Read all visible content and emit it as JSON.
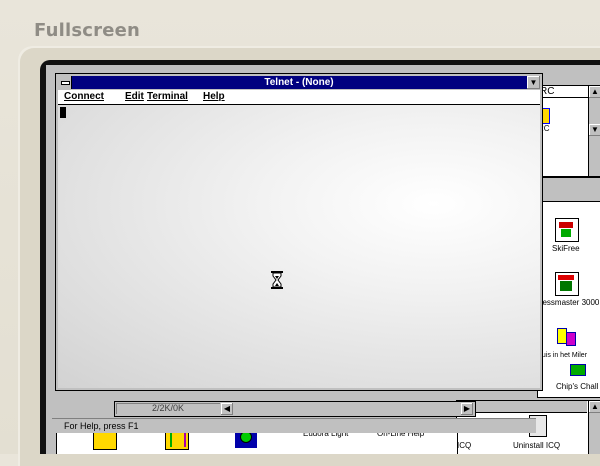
{
  "page_header": "Fullscreen",
  "telnet": {
    "title": "Telnet - (None)",
    "menu": [
      "Connect",
      "Edit",
      "Terminal",
      "Help"
    ],
    "status": "For Help, press F1"
  },
  "background": {
    "top_group_title_fragment": "RC",
    "top_icon_label_fragment": "RC",
    "games": [
      "SkiFree",
      "hessmaster 3000",
      "huis in het Miler",
      "Chip's Chall"
    ],
    "file_status": "2/2K/0K",
    "bottom_apps": [
      "Eudora Light",
      "On-Line Help",
      "ICQ",
      "Uninstall ICQ"
    ]
  },
  "colors": {
    "titlebar": "#000080",
    "window_face": "#c0c0c0",
    "page_background": "#e6e2d7"
  }
}
